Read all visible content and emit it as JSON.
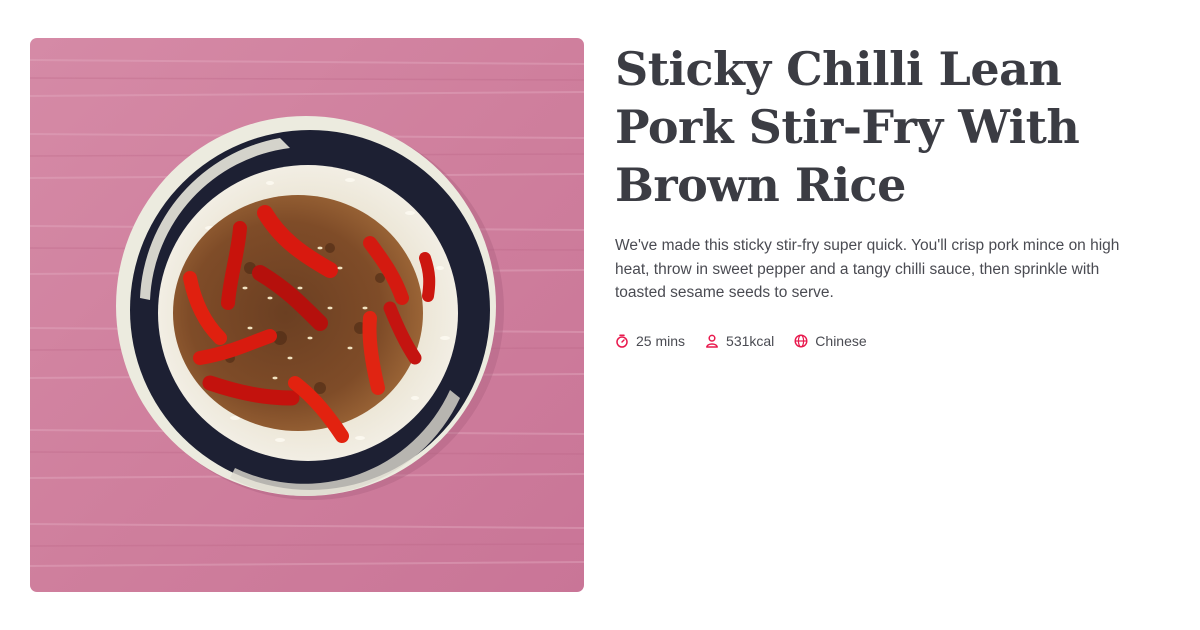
{
  "recipe": {
    "title": "Sticky Chilli Lean Pork Stir-Fry With Brown Rice",
    "description": "We've made this sticky stir-fry super quick. You'll crisp pork mince on high heat, throw in sweet pepper and a tangy chilli sauce, then sprinkle with toasted sesame seeds to serve.",
    "meta": {
      "time": "25 mins",
      "calories": "531kcal",
      "cuisine": "Chinese"
    },
    "icons": {
      "time": "stopwatch-icon",
      "calories": "person-icon",
      "cuisine": "globe-icon"
    },
    "colors": {
      "accent": "#e8194d",
      "title": "#3b3c43",
      "text": "#4a4b52"
    }
  }
}
